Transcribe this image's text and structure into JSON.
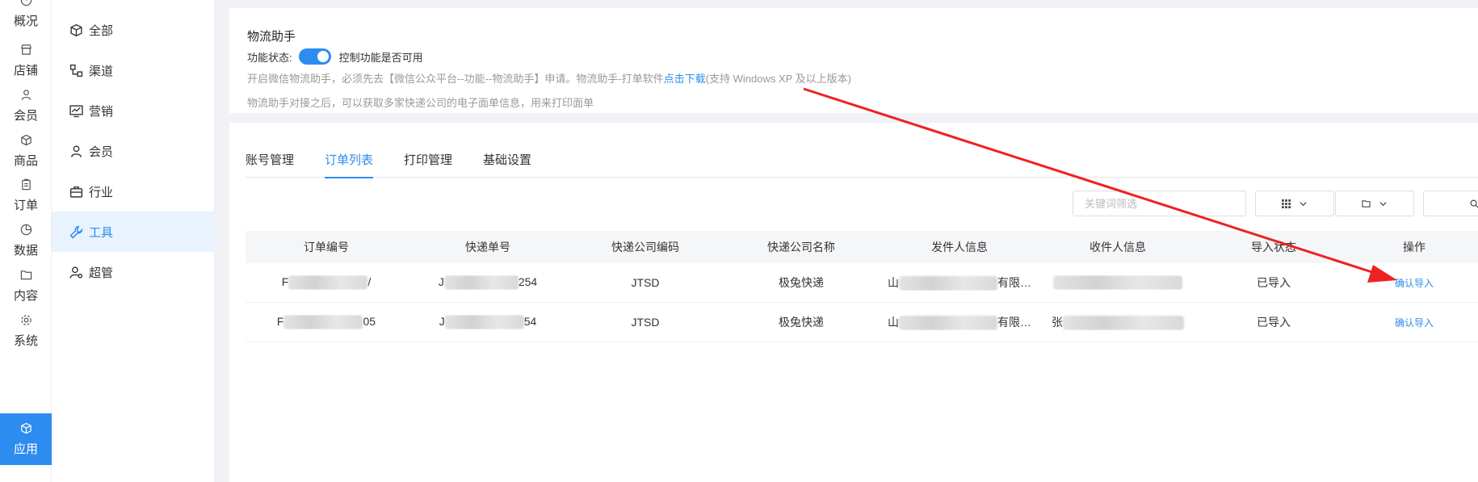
{
  "primary_nav": [
    {
      "label": "概况",
      "icon": "dashboard-icon"
    },
    {
      "label": "店铺",
      "icon": "store-icon"
    },
    {
      "label": "会员",
      "icon": "user-icon"
    },
    {
      "label": "商品",
      "icon": "box-icon"
    },
    {
      "label": "订单",
      "icon": "clipboard-icon"
    },
    {
      "label": "数据",
      "icon": "pie-chart-icon"
    },
    {
      "label": "内容",
      "icon": "folder-icon"
    },
    {
      "label": "系统",
      "icon": "gear-icon"
    },
    {
      "label": "应用",
      "icon": "cube-icon",
      "active": true
    }
  ],
  "secondary_nav": [
    {
      "label": "全部",
      "icon": "cube-icon"
    },
    {
      "label": "渠道",
      "icon": "channel-icon"
    },
    {
      "label": "营销",
      "icon": "chart-monitor-icon"
    },
    {
      "label": "会员",
      "icon": "user-icon"
    },
    {
      "label": "行业",
      "icon": "briefcase-icon"
    },
    {
      "label": "工具",
      "icon": "wrench-icon",
      "active": true
    },
    {
      "label": "超管",
      "icon": "admin-user-icon"
    }
  ],
  "helper": {
    "title": "物流助手",
    "status_label": "功能状态:",
    "toggle_on": true,
    "toggle_desc": "控制功能是否可用",
    "desc_prefix": "开启微信物流助手，必须先去【微信公众平台--功能--物流助手】申请。物流助手-打单软件",
    "desc_link": "点击下载",
    "desc_suffix": "(支持 Windows XP 及以上版本)",
    "desc2": "物流助手对接之后，可以获取多家快递公司的电子面单信息，用来打印面单"
  },
  "tabs": [
    {
      "label": "账号管理"
    },
    {
      "label": "订单列表",
      "active": true
    },
    {
      "label": "打印管理"
    },
    {
      "label": "基础设置"
    }
  ],
  "filters": {
    "keyword_placeholder": "关键词筛选"
  },
  "table": {
    "headers": [
      "订单编号",
      "快递单号",
      "快递公司编码",
      "快递公司名称",
      "发件人信息",
      "收件人信息",
      "导入状态",
      "操作"
    ],
    "rows": [
      {
        "order_pre": "F",
        "order_suf": "/",
        "track_pre": "J",
        "track_suf": "254",
        "code": "JTSD",
        "company": "极兔快递",
        "sender_pre": "山",
        "sender_suf": "有限…",
        "recv_pre": "",
        "status": "已导入",
        "action": "确认导入"
      },
      {
        "order_pre": "F",
        "order_suf": "05",
        "track_pre": "J",
        "track_suf": "54",
        "code": "JTSD",
        "company": "极兔快递",
        "sender_pre": "山",
        "sender_suf": "有限…",
        "recv_pre": "张",
        "status": "已导入",
        "action": "确认导入"
      }
    ]
  },
  "colors": {
    "accent": "#2d8cf0",
    "annotation_arrow": "#ee2222"
  }
}
